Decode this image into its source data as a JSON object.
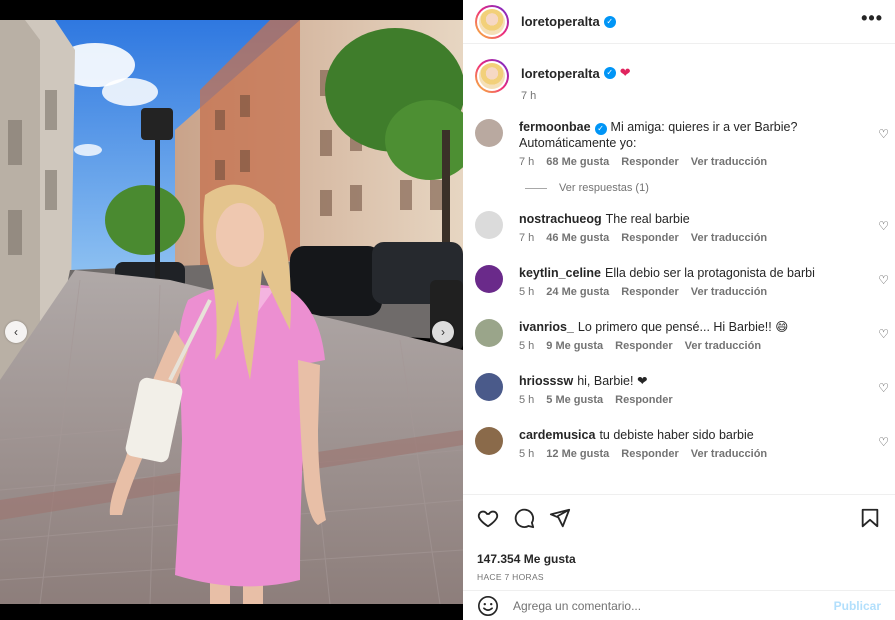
{
  "post": {
    "username": "loretoperalta",
    "caption_emoji": "❤",
    "caption_time": "7 h",
    "likes": "147.354 Me gusta",
    "time_ago": "HACE 7 HORAS",
    "more_icon": "more-options-icon",
    "more_label": "•••"
  },
  "carousel": {
    "prev_label": "‹",
    "next_label": "›",
    "slides": 3,
    "active_slide": 2
  },
  "comments": [
    {
      "user": "fermoonbae",
      "verified": true,
      "text": "Mi amiga: quieres ir a ver Barbie? Automáticamente yo:",
      "time": "7 h",
      "likes": "68 Me gusta",
      "reply": "Responder",
      "translate": "Ver traducción",
      "avatar_color": "#b9a9a0"
    },
    {
      "user": "nostrachueog",
      "verified": false,
      "text": "The real barbie",
      "time": "7 h",
      "likes": "46 Me gusta",
      "reply": "Responder",
      "translate": "Ver traducción",
      "avatar_color": "#dbdbdb"
    },
    {
      "user": "keytlin_celine",
      "verified": false,
      "text": "Ella debio ser la protagonista de barbi",
      "time": "5 h",
      "likes": "24 Me gusta",
      "reply": "Responder",
      "translate": "Ver traducción",
      "avatar_color": "#6a2a8a"
    },
    {
      "user": "ivanrios_",
      "verified": false,
      "text": "Lo primero que pensé... Hi Barbie!! 😄",
      "time": "5 h",
      "likes": "9 Me gusta",
      "reply": "Responder",
      "translate": "Ver traducción",
      "avatar_color": "#9aa58a"
    },
    {
      "user": "hriosssw",
      "verified": false,
      "text": "hi, Barbie! ❤",
      "time": "5 h",
      "likes": "5 Me gusta",
      "reply": "Responder",
      "translate": "",
      "avatar_color": "#4a5a8a"
    },
    {
      "user": "cardemusica",
      "verified": false,
      "text": "tu debiste haber sido barbie",
      "time": "5 h",
      "likes": "12 Me gusta",
      "reply": "Responder",
      "translate": "Ver traducción",
      "avatar_color": "#8a6a4a"
    }
  ],
  "view_replies": "Ver respuestas (1)",
  "add_comment": {
    "placeholder": "Agrega un comentario...",
    "publish": "Publicar",
    "emoji_icon": "emoji-icon"
  },
  "colors": {
    "accent": "#0095f6",
    "muted": "#737373",
    "publish_disabled": "#b2dffc",
    "dress_pink": "#ec8fd1"
  }
}
